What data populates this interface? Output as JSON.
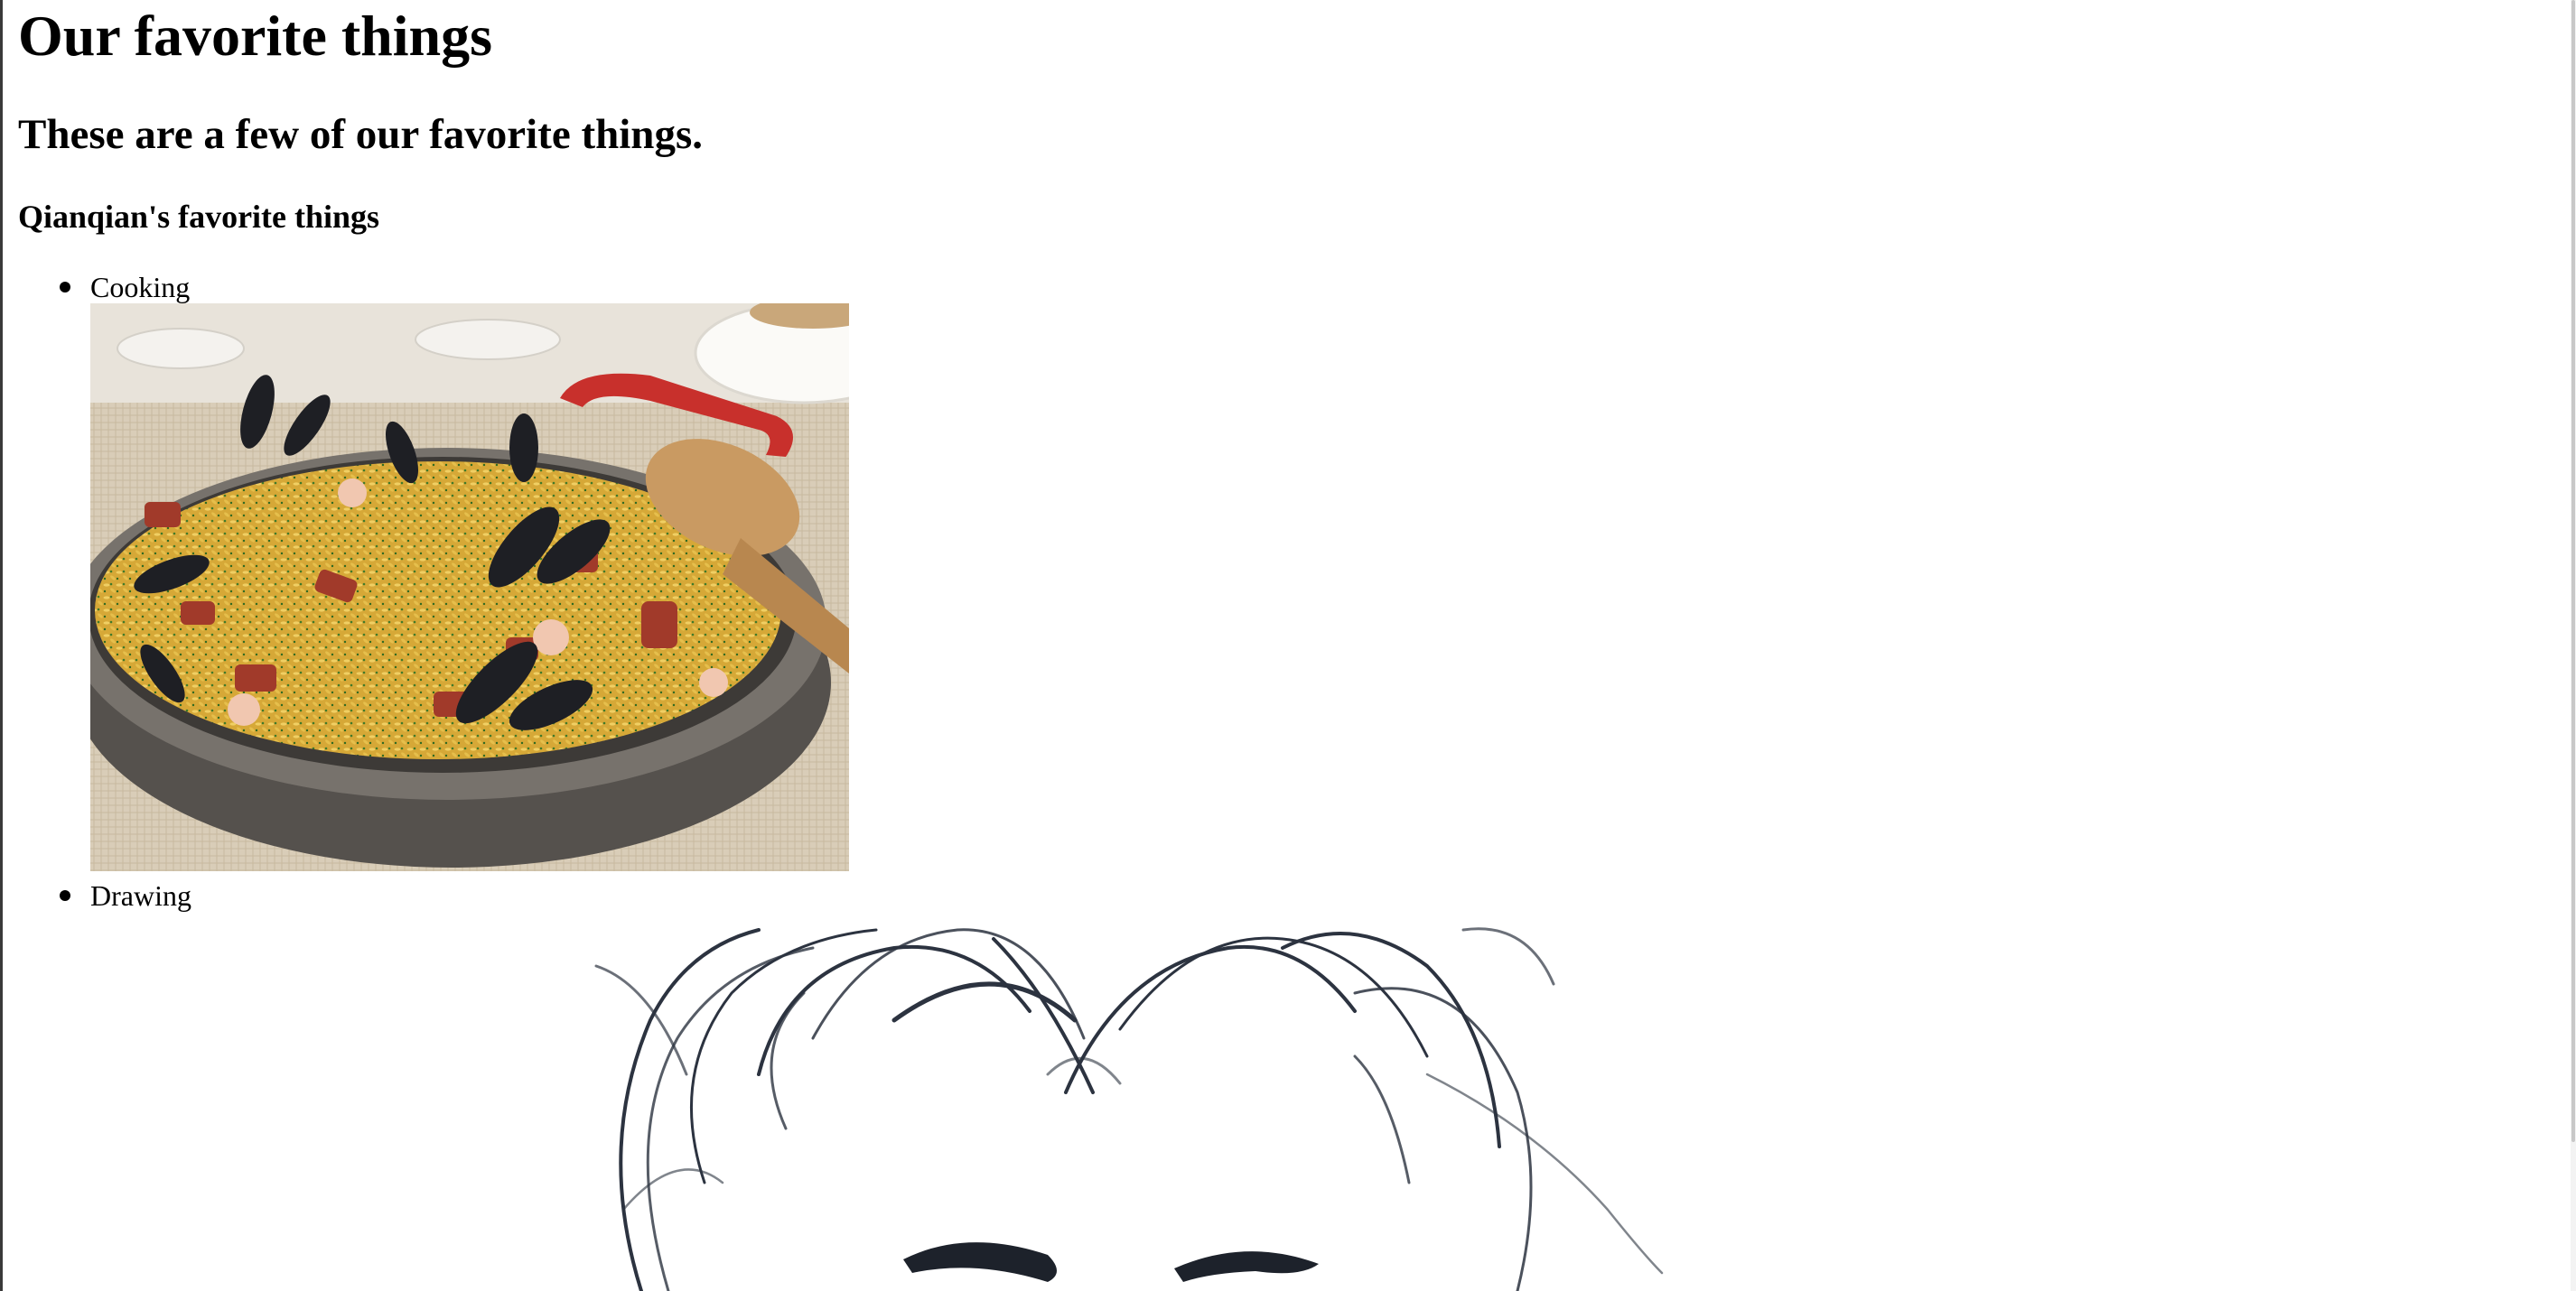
{
  "page": {
    "title": "Our favorite things",
    "subtitle": "These are a few of our favorite things.",
    "section_heading": "Qianqian's favorite things"
  },
  "favorites": {
    "items": [
      {
        "label": "Cooking",
        "image_icon": "paella-photo"
      },
      {
        "label": "Drawing",
        "image_icon": "portrait-sketch"
      }
    ]
  },
  "colors": {
    "background": "#ffffff",
    "text": "#000000",
    "pan_handle": "#c8302c",
    "pan_metal": "#5e5a56",
    "rice": "#d9ad3c",
    "sketch_ink": "#2c3340"
  }
}
